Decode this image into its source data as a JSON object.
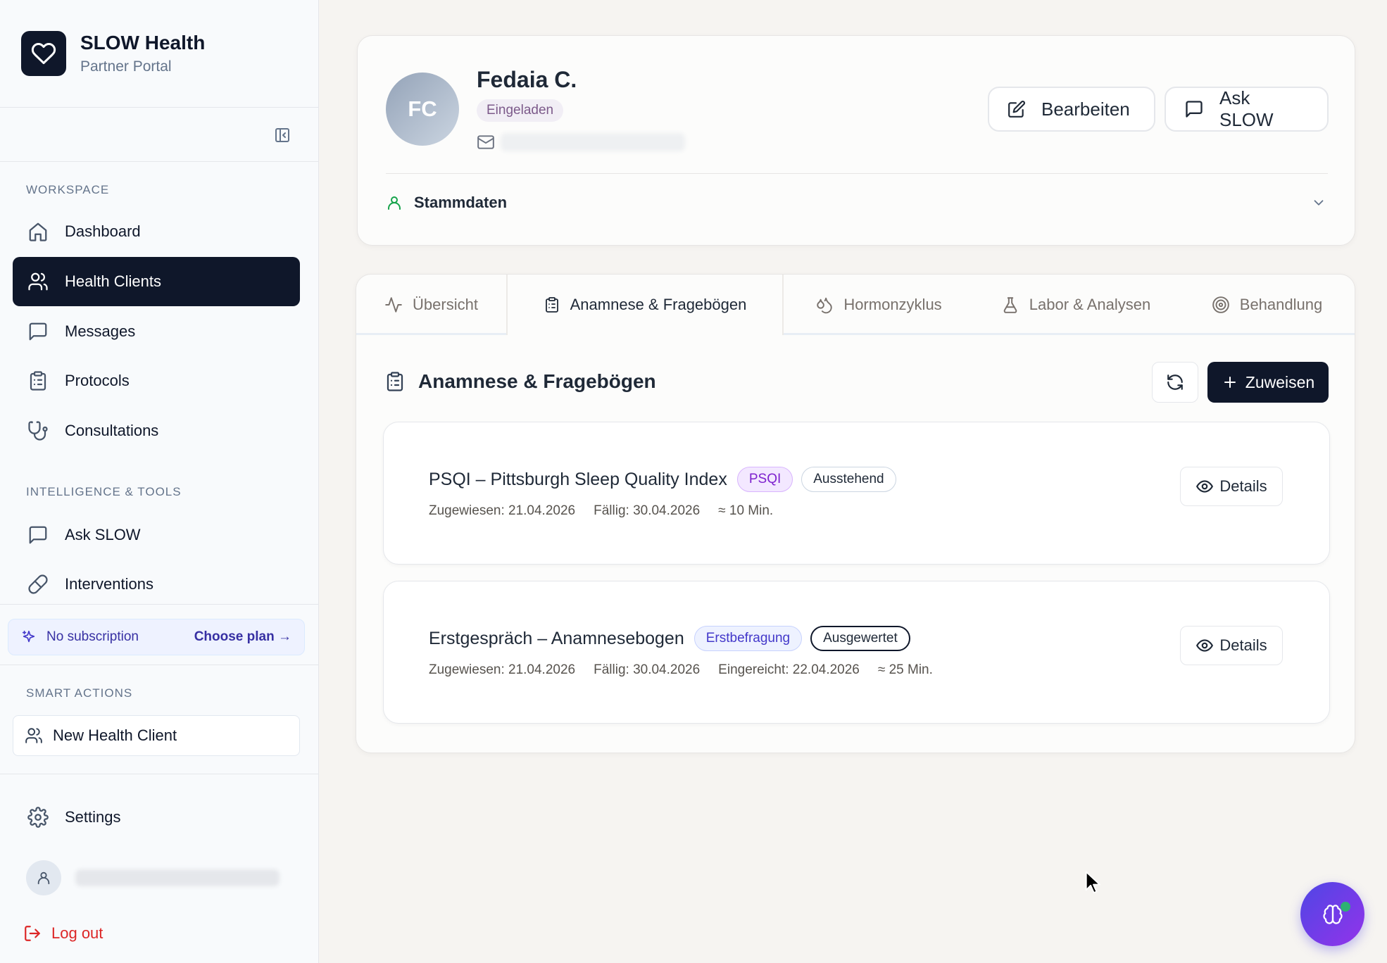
{
  "brand": {
    "title": "SLOW Health",
    "subtitle": "Partner Portal"
  },
  "sidebar": {
    "workspace_label": "WORKSPACE",
    "workspace_items": [
      {
        "label": "Dashboard",
        "icon": "home-icon"
      },
      {
        "label": "Health Clients",
        "icon": "users-icon",
        "active": true
      },
      {
        "label": "Messages",
        "icon": "message-icon"
      },
      {
        "label": "Protocols",
        "icon": "clipboard-icon"
      },
      {
        "label": "Consultations",
        "icon": "stethoscope-icon"
      }
    ],
    "tools_label": "INTELLIGENCE & TOOLS",
    "tools_items": [
      {
        "label": "Ask SLOW",
        "icon": "message-icon"
      },
      {
        "label": "Interventions",
        "icon": "pill-icon"
      }
    ],
    "subscription": {
      "status": "No subscription",
      "cta": "Choose plan →"
    },
    "smart_actions_label": "SMART ACTIONS",
    "smart_actions": [
      {
        "label": "New Health Client",
        "icon": "users-icon"
      }
    ],
    "settings_label": "Settings",
    "logout_label": "Log out"
  },
  "client": {
    "initials": "FC",
    "name": "Fedaia C.",
    "status": "Eingeladen",
    "edit_label": "Bearbeiten",
    "ask_label": "Ask SLOW",
    "master_data_label": "Stammdaten"
  },
  "tabs": [
    {
      "label": "Übersicht",
      "icon": "activity-icon"
    },
    {
      "label": "Anamnese & Fragebögen",
      "icon": "clipboard-icon",
      "active": true
    },
    {
      "label": "Hormonzyklus",
      "icon": "droplets-icon"
    },
    {
      "label": "Labor & Analysen",
      "icon": "flask-icon"
    },
    {
      "label": "Behandlung",
      "icon": "target-icon"
    }
  ],
  "questionnaires": {
    "heading": "Anamnese & Fragebögen",
    "assign_label": "Zuweisen",
    "items": [
      {
        "title": "PSQI – Pittsburgh Sleep Quality Index",
        "tag": "PSQI",
        "status": "Ausstehend",
        "assigned": "Zugewiesen: 21.04.2026",
        "due": "Fällig: 30.04.2026",
        "duration": "≈ 10 Min.",
        "details_label": "Details"
      },
      {
        "title": "Erstgespräch – Anamnesebogen",
        "tag": "Erstbefragung",
        "status": "Ausgewertet",
        "assigned": "Zugewiesen: 21.04.2026",
        "due": "Fällig: 30.04.2026",
        "submitted": "Eingereicht: 22.04.2026",
        "duration": "≈ 25 Min.",
        "details_label": "Details"
      }
    ]
  },
  "colors": {
    "primary_dark": "#0f172a",
    "accent_indigo": "#4338ca",
    "accent_purple": "#7e22ce",
    "danger": "#dc2626",
    "success": "#22c55e"
  }
}
